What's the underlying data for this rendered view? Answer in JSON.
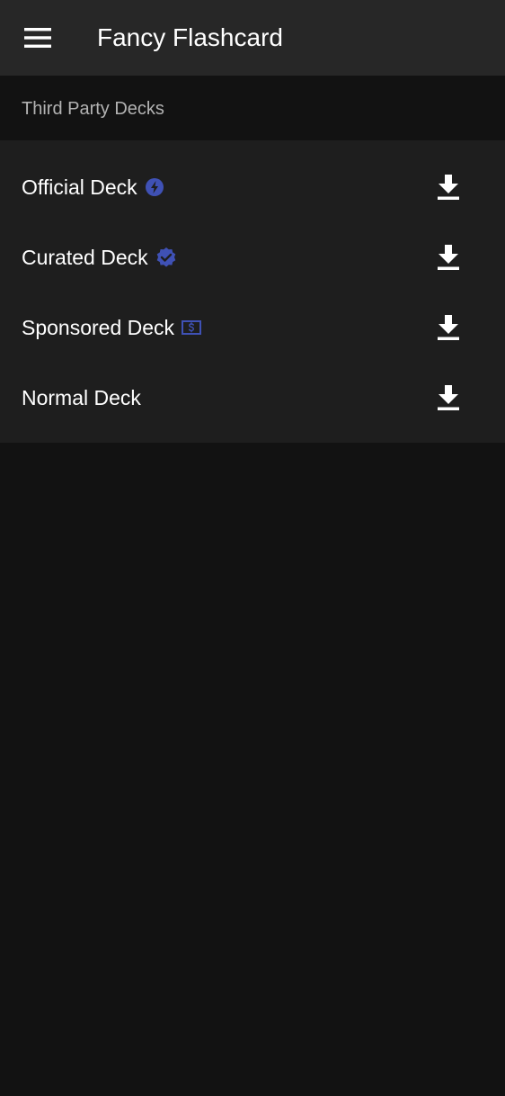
{
  "appbar": {
    "menu_icon": "hamburger-menu-icon",
    "title": "Fancy Flashcard"
  },
  "section": {
    "title": "Third Party Decks"
  },
  "decks": [
    {
      "label": "Official Deck",
      "badge_icon": "lightning-circle-icon",
      "action_icon": "download-icon"
    },
    {
      "label": "Curated Deck",
      "badge_icon": "verified-badge-icon",
      "action_icon": "download-icon"
    },
    {
      "label": "Sponsored Deck",
      "badge_icon": "money-icon",
      "action_icon": "download-icon"
    },
    {
      "label": "Normal Deck",
      "badge_icon": null,
      "action_icon": "download-icon"
    }
  ],
  "colors": {
    "appbar_bg": "#272727",
    "page_bg": "#121212",
    "list_bg": "#1e1e1e",
    "badge_accent": "#3f51b5",
    "text_primary": "#ffffff",
    "text_secondary": "#b3b3b3"
  }
}
